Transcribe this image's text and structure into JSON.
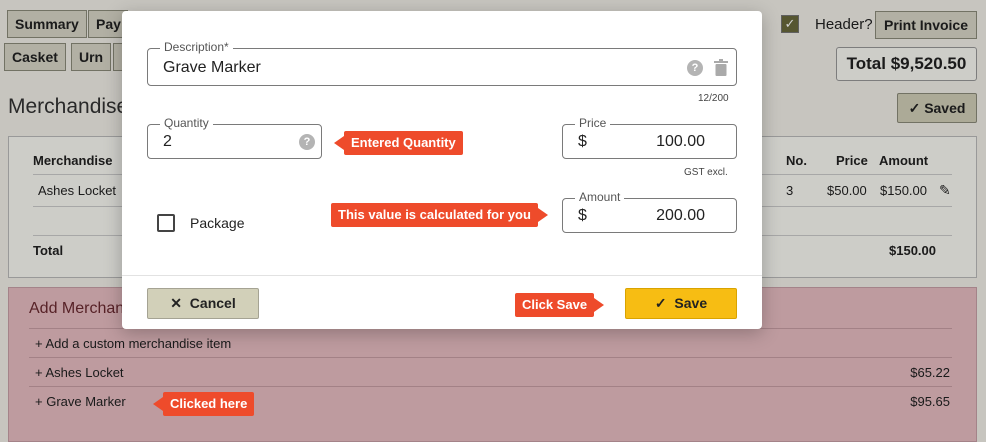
{
  "tabs_row1": [
    "Summary",
    "Pay"
  ],
  "tabs_row2": [
    "Casket",
    "Urn"
  ],
  "header": {
    "checkbox_label": "Header?",
    "print_label": "Print Invoice",
    "total_label": "Total $9,520.50"
  },
  "section": {
    "title": "Merchandise",
    "saved_label": "Saved"
  },
  "merch_table": {
    "col_merchandise": "Merchandise",
    "col_no": "No.",
    "col_price": "Price",
    "col_amount": "Amount",
    "row_name": "Ashes Locket",
    "row_no": "3",
    "row_price": "$50.00",
    "row_amount": "$150.00",
    "total_label": "Total",
    "total_value": "$150.00"
  },
  "add_panel": {
    "title": "Add Merchan",
    "items": [
      {
        "label": "Add a custom merchandise item",
        "price": ""
      },
      {
        "label": "Ashes Locket",
        "price": "$65.22"
      },
      {
        "label": "Grave Marker",
        "price": "$95.65"
      }
    ]
  },
  "modal": {
    "description_label": "Description*",
    "description_value": "Grave Marker",
    "description_counter": "12/200",
    "quantity_label": "Quantity",
    "quantity_value": "2",
    "price_label": "Price",
    "price_currency": "$",
    "price_value": "100.00",
    "price_note": "GST excl.",
    "amount_label": "Amount",
    "amount_currency": "$",
    "amount_value": "200.00",
    "package_label": "Package",
    "cancel_label": "Cancel",
    "save_label": "Save"
  },
  "callouts": {
    "quantity": "Entered Quantity",
    "amount": "This value is calculated for you",
    "save": "Click Save",
    "clicked": "Clicked here"
  },
  "colors": {
    "save_button": "#f7bd13",
    "callout": "#ee4b2b",
    "add_panel": "#e8bdc3"
  },
  "icons": [
    "check-icon",
    "help-icon",
    "trash-icon",
    "pencil-icon",
    "plus-icon",
    "close-icon"
  ]
}
